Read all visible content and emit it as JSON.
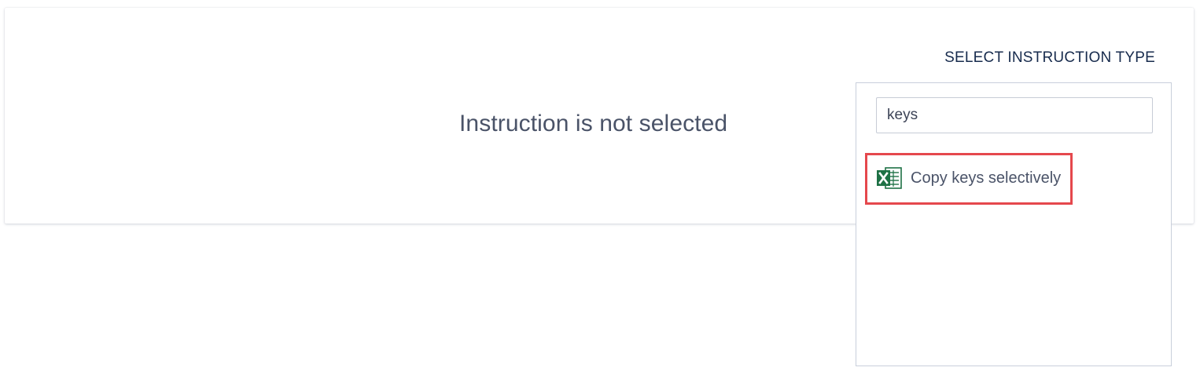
{
  "main": {
    "empty_message": "Instruction is not selected"
  },
  "instruction_panel": {
    "title": "SELECT INSTRUCTION TYPE",
    "search": {
      "value": "keys",
      "placeholder": ""
    },
    "options": [
      {
        "label": "Copy keys selectively",
        "icon": "excel-icon",
        "highlighted": true
      }
    ]
  },
  "colors": {
    "highlight_border": "#e5484d",
    "excel_green": "#1e7145",
    "title_text": "#172b4d",
    "body_text": "#4a5368"
  }
}
